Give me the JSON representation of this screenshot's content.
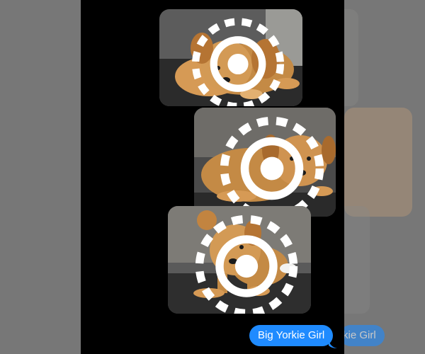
{
  "conversation": {
    "photos": [
      {
        "name": "puppy-photo-1",
        "live": true,
        "subject": "puppy-lying-on-blanket"
      },
      {
        "name": "puppy-photo-2",
        "live": true,
        "subject": "puppy-resting-on-couch"
      },
      {
        "name": "puppy-photo-3",
        "live": true,
        "subject": "puppy-standing-on-blanket"
      }
    ],
    "message": {
      "text": "Big Yorkie Girl",
      "direction": "outgoing"
    },
    "ghost_message": {
      "text": "kie Girl"
    }
  },
  "colors": {
    "background": "#000000",
    "side_panel": "#777777",
    "bubble_blue": "#1f8bff",
    "bubble_text": "#ffffff",
    "puppy_fur": "#c9843f"
  },
  "icons": {
    "live_photo_badge": "live-photo-icon"
  }
}
